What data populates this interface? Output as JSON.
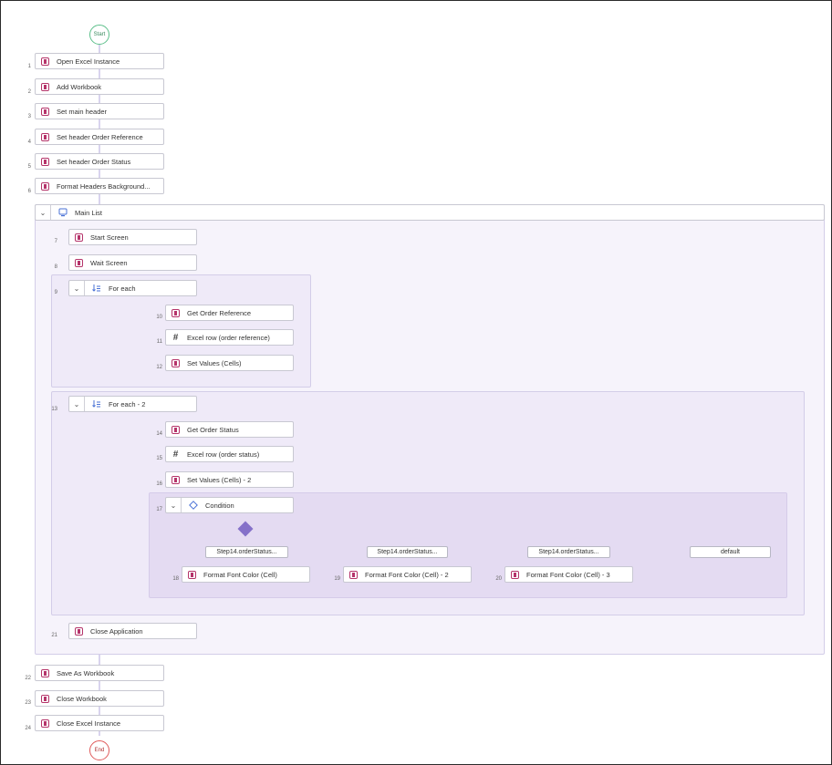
{
  "flow": {
    "start_label": "Start",
    "end_label": "End",
    "steps": {
      "s1": {
        "num": "1",
        "label": "Open Excel Instance"
      },
      "s2": {
        "num": "2",
        "label": "Add Workbook"
      },
      "s3": {
        "num": "3",
        "label": "Set main header"
      },
      "s4": {
        "num": "4",
        "label": "Set header Order Reference"
      },
      "s5": {
        "num": "5",
        "label": "Set header Order Status"
      },
      "s6": {
        "num": "6",
        "label": "Format Headers Background..."
      },
      "s7": {
        "num": "7",
        "label": "Start Screen"
      },
      "s8": {
        "num": "8",
        "label": "Wait Screen"
      },
      "s9": {
        "num": "9",
        "label": "For each"
      },
      "s10": {
        "num": "10",
        "label": "Get Order Reference"
      },
      "s11": {
        "num": "11",
        "label": "Excel row (order reference)"
      },
      "s12": {
        "num": "12",
        "label": "Set Values (Cells)"
      },
      "s13": {
        "num": "13",
        "label": "For each - 2"
      },
      "s14": {
        "num": "14",
        "label": "Get Order Status"
      },
      "s15": {
        "num": "15",
        "label": "Excel row (order status)"
      },
      "s16": {
        "num": "16",
        "label": "Set Values (Cells) - 2"
      },
      "s17": {
        "num": "17",
        "label": "Condition"
      },
      "s18": {
        "num": "18",
        "label": "Format Font Color (Cell)"
      },
      "s19": {
        "num": "19",
        "label": "Format Font Color (Cell) - 2"
      },
      "s20": {
        "num": "20",
        "label": "Format Font Color (Cell) - 3"
      },
      "s21": {
        "num": "21",
        "label": "Close Application"
      },
      "s22": {
        "num": "22",
        "label": "Save As Workbook"
      },
      "s23": {
        "num": "23",
        "label": "Close Workbook"
      },
      "s24": {
        "num": "24",
        "label": "Close Excel Instance"
      }
    },
    "main_list_label": "Main List",
    "cases": [
      "Step14.orderStatus...",
      "Step14.orderStatus...",
      "Step14.orderStatus...",
      "default"
    ]
  },
  "icons": {
    "activity": "activity-icon",
    "variable": "hash-variable-icon",
    "loop": "for-each-icon",
    "condition": "condition-diamond-icon",
    "screen": "screen-list-icon",
    "collapse": "chevron-down-icon"
  },
  "colors": {
    "accent": "#8571c9",
    "activity_icon": "#b5346a",
    "start": "#5cbf8a",
    "end": "#e05a5a",
    "wire": "#a79ad6"
  }
}
